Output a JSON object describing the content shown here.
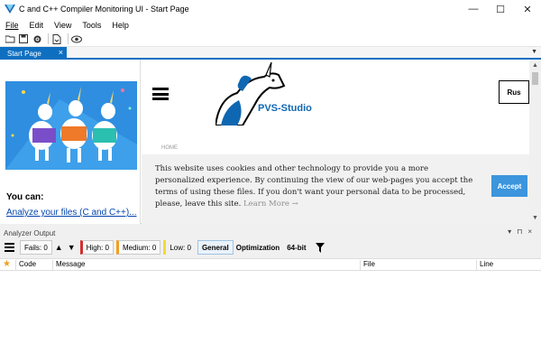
{
  "window": {
    "title": "C and C++ Compiler Monitoring UI - Start Page",
    "minimize": "—",
    "maximize": "☐",
    "close": "✕"
  },
  "menu": [
    "File",
    "Edit",
    "View",
    "Tools",
    "Help"
  ],
  "toolbar": {
    "icons": [
      "open-folder-icon",
      "save-icon",
      "settings-icon",
      "open-document-icon",
      "view-icon"
    ]
  },
  "tabs": [
    {
      "label": "Start Page",
      "close": "×"
    }
  ],
  "start_page": {
    "you_can": "You can:",
    "analyze_link": "Analyze your files (C and C++)...",
    "web": {
      "brand": "PVS-Studio",
      "lang_button": "Rus",
      "breadcrumb": "HOME",
      "cookie_text": "This website uses cookies and other technology to provide you a more personalized experience. By continuing the view of our web-pages you accept the terms of using these files. If you don't want your personal data to be processed, please, leave this site.",
      "cookie_more": "Learn More →",
      "accept": "Accept"
    }
  },
  "analyzer": {
    "title": "Analyzer Output",
    "fails": "Fails: 0",
    "high": "High: 0",
    "medium": "Medium: 0",
    "low": "Low: 0",
    "general": "General",
    "optimization": "Optimization",
    "bit64": "64-bit",
    "columns": [
      "Code",
      "Message",
      "File",
      "Line"
    ]
  },
  "colors": {
    "accent": "#0e6fc1",
    "high": "#d32f2f",
    "medium": "#f0a020",
    "low": "#f3dc30",
    "accept": "#3c95dd"
  }
}
